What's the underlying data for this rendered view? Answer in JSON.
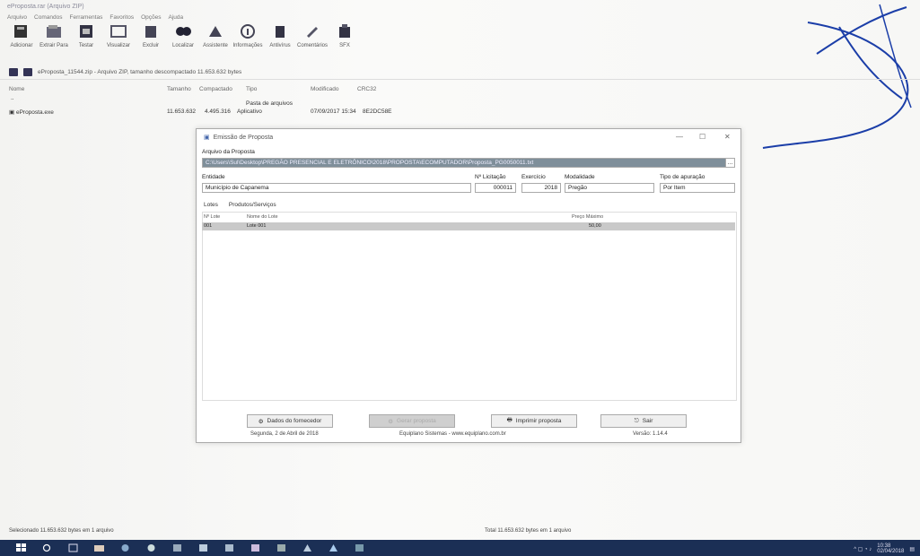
{
  "app": {
    "title": "eProposta.rar (Arquivo ZIP)"
  },
  "menu": [
    "Arquivo",
    "Comandos",
    "Ferramentas",
    "Favoritos",
    "Opções",
    "Ajuda"
  ],
  "toolbar": [
    {
      "label": "Adicionar",
      "icon": "add-icon"
    },
    {
      "label": "Extrair Para",
      "icon": "extract-icon"
    },
    {
      "label": "Testar",
      "icon": "test-icon"
    },
    {
      "label": "Visualizar",
      "icon": "view-icon"
    },
    {
      "label": "Excluir",
      "icon": "delete-icon"
    },
    {
      "label": "Localizar",
      "icon": "find-icon"
    },
    {
      "label": "Assistente",
      "icon": "wizard-icon"
    },
    {
      "label": "Informações",
      "icon": "info-icon"
    },
    {
      "label": "Antivírus",
      "icon": "antivirus-icon"
    },
    {
      "label": "Comentários",
      "icon": "comment-icon"
    },
    {
      "label": "SFX",
      "icon": "sfx-icon"
    }
  ],
  "address": "eProposta_11544.zip - Arquivo ZIP, tamanho descompactado 11.653.632 bytes",
  "columns": {
    "name": "Nome",
    "size": "Tamanho",
    "packed": "Compactado",
    "type": "Tipo",
    "modified": "Modificado",
    "crc": "CRC32"
  },
  "files": [
    {
      "name": "..",
      "size": "",
      "packed": "",
      "type": "Pasta de arquivos",
      "modified": "",
      "crc": ""
    },
    {
      "name": "eProposta.exe",
      "size": "11.653.632",
      "packed": "4.495.316",
      "type": "Aplicativo",
      "modified": "07/09/2017 15:34",
      "crc": "8E2DC58E"
    }
  ],
  "dialog": {
    "title": "Emissão de Proposta",
    "arquivo_label": "Arquivo da Proposta",
    "arquivo_value": "C:\\Users\\Sul\\Desktop\\PREGÃO PRESENCIAL E ELETRÔNICO\\2018\\PROPOSTA\\ECOMPUTADOR\\Proposta_PG0050011.txt",
    "entidade_label": "Entidade",
    "entidade_value": "Município de Capanema",
    "licitacao_label": "Nº Licitação",
    "licitacao_value": "000011",
    "exercicio_label": "Exercício",
    "exercicio_value": "2018",
    "modalidade_label": "Modalidade",
    "modalidade_value": "Pregão",
    "apuracao_label": "Tipo de apuração",
    "apuracao_value": "Por Item",
    "tab_lotes": "Lotes",
    "tab_produtos": "Produtos/Serviços",
    "lote_columns": {
      "num": "Nº Lote",
      "name": "Nome do Lote",
      "price": "Preço Máximo"
    },
    "lote_row": {
      "num": "001",
      "name": "Lote 001",
      "price": "50,00"
    },
    "buttons": {
      "fornecedor": "Dados do fornecedor",
      "disabled": "Gerar proposta",
      "imprimir": "Imprimir proposta",
      "sair": "Sair"
    },
    "status_date": "Segunda, 2 de Abril de 2018",
    "status_company": "Equiplano Sistemas - www.equiplano.com.br",
    "status_version": "Versão: 1.14.4"
  },
  "appstatus_left": "Selecionado 11.653.632 bytes em 1 arquivo",
  "appstatus_right": "Total 11.653.632 bytes em 1 arquivo",
  "taskbar": {
    "time": "10:38",
    "date": "02/04/2018"
  }
}
